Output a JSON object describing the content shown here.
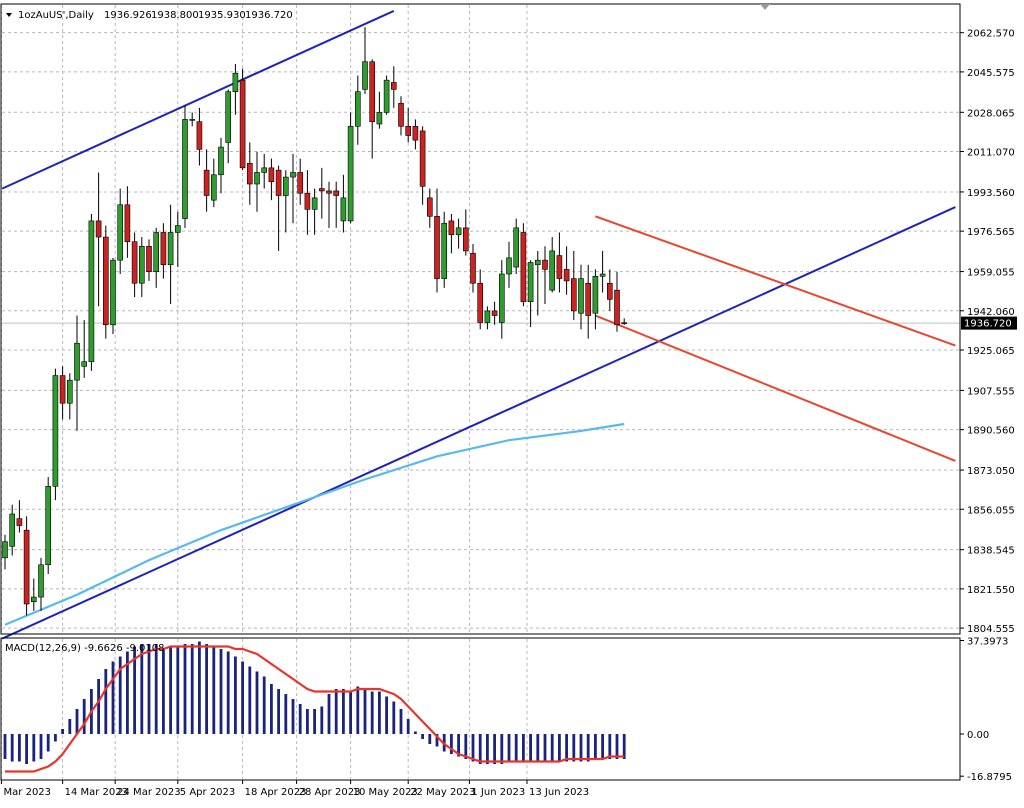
{
  "header": {
    "symbol": "1ozAuUS',Daily",
    "open": "1936.926",
    "high": "1938.800",
    "low": "1935.930",
    "close": "1936.720"
  },
  "price_axis": {
    "ticks": [
      "2062.570",
      "2045.575",
      "2028.065",
      "2011.070",
      "1993.560",
      "1976.565",
      "1959.055",
      "1942.060",
      "1925.065",
      "1907.555",
      "1890.560",
      "1873.050",
      "1856.055",
      "1838.545",
      "1821.550",
      "1804.555"
    ],
    "current_price_label": "1936.720"
  },
  "macd_panel": {
    "label": "MACD(12,26,9) -9.6626 -9.0108",
    "ticks": [
      "37.3973",
      "0.00",
      "-16.8795"
    ]
  },
  "date_axis": {
    "labels": [
      "2 Mar 2023",
      "14 Mar 2023",
      "24 Mar 2023",
      "5 Apr 2023",
      "18 Apr 2023",
      "28 Apr 2023",
      "10 May 2023",
      "22 May 2023",
      "1 Jun 2023",
      "13 Jun 2023"
    ]
  },
  "colors": {
    "bull": "#2e9d2e",
    "bear": "#cc2222",
    "wick": "#000000",
    "channel_blue": "#1f24b8",
    "channel_red": "#e8462d",
    "ma": "#57b9ee",
    "macd_hist": "#1a237e",
    "macd_signal": "#e8352a",
    "grid": "#b8b8b8"
  },
  "chart_data": {
    "type": "candlestick",
    "title": "1ozAuUS',Daily",
    "ylim": [
      1802,
      2075
    ],
    "candles": [
      {
        "o": 1835,
        "h": 1845,
        "l": 1830,
        "c": 1842
      },
      {
        "o": 1840,
        "h": 1858,
        "l": 1836,
        "c": 1854
      },
      {
        "o": 1852,
        "h": 1860,
        "l": 1846,
        "c": 1849
      },
      {
        "o": 1847,
        "h": 1853,
        "l": 1810,
        "c": 1815
      },
      {
        "o": 1816,
        "h": 1826,
        "l": 1812,
        "c": 1818
      },
      {
        "o": 1818,
        "h": 1835,
        "l": 1812,
        "c": 1832
      },
      {
        "o": 1832,
        "h": 1870,
        "l": 1828,
        "c": 1866
      },
      {
        "o": 1866,
        "h": 1917,
        "l": 1860,
        "c": 1914
      },
      {
        "o": 1914,
        "h": 1918,
        "l": 1895,
        "c": 1902
      },
      {
        "o": 1902,
        "h": 1915,
        "l": 1895,
        "c": 1912
      },
      {
        "o": 1912,
        "h": 1940,
        "l": 1890,
        "c": 1928
      },
      {
        "o": 1918,
        "h": 1938,
        "l": 1913,
        "c": 1920
      },
      {
        "o": 1920,
        "h": 1984,
        "l": 1916,
        "c": 1981
      },
      {
        "o": 1981,
        "h": 2002,
        "l": 1944,
        "c": 1974
      },
      {
        "o": 1974,
        "h": 1979,
        "l": 1930,
        "c": 1936
      },
      {
        "o": 1936,
        "h": 1965,
        "l": 1932,
        "c": 1964
      },
      {
        "o": 1964,
        "h": 1995,
        "l": 1958,
        "c": 1988
      },
      {
        "o": 1988,
        "h": 1996,
        "l": 1965,
        "c": 1972
      },
      {
        "o": 1972,
        "h": 1976,
        "l": 1948,
        "c": 1954
      },
      {
        "o": 1954,
        "h": 1974,
        "l": 1948,
        "c": 1970
      },
      {
        "o": 1970,
        "h": 1973,
        "l": 1955,
        "c": 1959
      },
      {
        "o": 1959,
        "h": 1978,
        "l": 1952,
        "c": 1976
      },
      {
        "o": 1976,
        "h": 1980,
        "l": 1956,
        "c": 1962
      },
      {
        "o": 1962,
        "h": 1988,
        "l": 1945,
        "c": 1976
      },
      {
        "o": 1976,
        "h": 1985,
        "l": 1961,
        "c": 1979
      },
      {
        "o": 1982,
        "h": 2031,
        "l": 1978,
        "c": 2025
      },
      {
        "o": 2025,
        "h": 2028,
        "l": 2022,
        "c": 2025
      },
      {
        "o": 2024,
        "h": 2030,
        "l": 2005,
        "c": 2012
      },
      {
        "o": 2003,
        "h": 2012,
        "l": 1985,
        "c": 1992
      },
      {
        "o": 1990,
        "h": 2008,
        "l": 1987,
        "c": 2001
      },
      {
        "o": 2001,
        "h": 2017,
        "l": 1993,
        "c": 2013
      },
      {
        "o": 2015,
        "h": 2038,
        "l": 2006,
        "c": 2037
      },
      {
        "o": 2037,
        "h": 2049,
        "l": 2027,
        "c": 2045
      },
      {
        "o": 2042,
        "h": 2047,
        "l": 2003,
        "c": 2004
      },
      {
        "o": 2006,
        "h": 2015,
        "l": 1988,
        "c": 1997
      },
      {
        "o": 1997,
        "h": 2011,
        "l": 1985,
        "c": 2002
      },
      {
        "o": 2002,
        "h": 2010,
        "l": 1995,
        "c": 2004
      },
      {
        "o": 2004,
        "h": 2008,
        "l": 1990,
        "c": 1998
      },
      {
        "o": 2003,
        "h": 2005,
        "l": 1968,
        "c": 1992
      },
      {
        "o": 1992,
        "h": 2003,
        "l": 1976,
        "c": 2000
      },
      {
        "o": 2000,
        "h": 2010,
        "l": 1980,
        "c": 2002
      },
      {
        "o": 2002,
        "h": 2008,
        "l": 1988,
        "c": 1993
      },
      {
        "o": 1993,
        "h": 2003,
        "l": 1975,
        "c": 1986
      },
      {
        "o": 1986,
        "h": 1995,
        "l": 1975,
        "c": 1991
      },
      {
        "o": 1995,
        "h": 2004,
        "l": 1982,
        "c": 1994
      },
      {
        "o": 1994,
        "h": 1998,
        "l": 1978,
        "c": 1993
      },
      {
        "o": 1994,
        "h": 1998,
        "l": 1978,
        "c": 1992
      },
      {
        "o": 1981,
        "h": 2001,
        "l": 1976,
        "c": 1991
      },
      {
        "o": 1981,
        "h": 2028,
        "l": 1980,
        "c": 2022
      },
      {
        "o": 2022,
        "h": 2044,
        "l": 2014,
        "c": 2037
      },
      {
        "o": 2038,
        "h": 2065,
        "l": 2036,
        "c": 2050
      },
      {
        "o": 2050,
        "h": 2051,
        "l": 2008,
        "c": 2024
      },
      {
        "o": 2023,
        "h": 2037,
        "l": 2021,
        "c": 2028
      },
      {
        "o": 2028,
        "h": 2044,
        "l": 2027,
        "c": 2042
      },
      {
        "o": 2041,
        "h": 2048,
        "l": 2030,
        "c": 2038
      },
      {
        "o": 2032,
        "h": 2035,
        "l": 2018,
        "c": 2022
      },
      {
        "o": 2022,
        "h": 2030,
        "l": 2015,
        "c": 2018
      },
      {
        "o": 2022,
        "h": 2025,
        "l": 2012,
        "c": 2016
      },
      {
        "o": 2020,
        "h": 2022,
        "l": 1988,
        "c": 1996
      },
      {
        "o": 1991,
        "h": 1995,
        "l": 1978,
        "c": 1983
      },
      {
        "o": 1983,
        "h": 1995,
        "l": 1950,
        "c": 1956
      },
      {
        "o": 1956,
        "h": 1985,
        "l": 1952,
        "c": 1980
      },
      {
        "o": 1981,
        "h": 1984,
        "l": 1967,
        "c": 1975
      },
      {
        "o": 1975,
        "h": 1982,
        "l": 1969,
        "c": 1978
      },
      {
        "o": 1978,
        "h": 1986,
        "l": 1966,
        "c": 1968
      },
      {
        "o": 1967,
        "h": 1971,
        "l": 1950,
        "c": 1954
      },
      {
        "o": 1954,
        "h": 1960,
        "l": 1934,
        "c": 1937
      },
      {
        "o": 1937,
        "h": 1944,
        "l": 1934,
        "c": 1942
      },
      {
        "o": 1942,
        "h": 1946,
        "l": 1936,
        "c": 1940
      },
      {
        "o": 1937,
        "h": 1964,
        "l": 1930,
        "c": 1958
      },
      {
        "o": 1958,
        "h": 1972,
        "l": 1952,
        "c": 1965
      },
      {
        "o": 1961,
        "h": 1982,
        "l": 1958,
        "c": 1978
      },
      {
        "o": 1976,
        "h": 1980,
        "l": 1944,
        "c": 1946
      },
      {
        "o": 1946,
        "h": 1964,
        "l": 1935,
        "c": 1963
      },
      {
        "o": 1962,
        "h": 1968,
        "l": 1940,
        "c": 1964
      },
      {
        "o": 1964,
        "h": 1970,
        "l": 1945,
        "c": 1960
      },
      {
        "o": 1951,
        "h": 1974,
        "l": 1950,
        "c": 1968
      },
      {
        "o": 1966,
        "h": 1976,
        "l": 1950,
        "c": 1956
      },
      {
        "o": 1960,
        "h": 1970,
        "l": 1949,
        "c": 1955
      },
      {
        "o": 1956,
        "h": 1968,
        "l": 1938,
        "c": 1942
      },
      {
        "o": 1941,
        "h": 1962,
        "l": 1934,
        "c": 1956
      },
      {
        "o": 1954,
        "h": 1962,
        "l": 1930,
        "c": 1940
      },
      {
        "o": 1941,
        "h": 1960,
        "l": 1934,
        "c": 1957
      },
      {
        "o": 1957,
        "h": 1968,
        "l": 1950,
        "c": 1958
      },
      {
        "o": 1954,
        "h": 1960,
        "l": 1942,
        "c": 1947
      },
      {
        "o": 1951,
        "h": 1959,
        "l": 1933,
        "c": 1936
      },
      {
        "o": 1936.9,
        "h": 1938.8,
        "l": 1935.9,
        "c": 1936.7
      }
    ],
    "trendlines": [
      {
        "name": "blue-upper",
        "color": "blue",
        "x": [
          -0.4,
          54.0
        ],
        "y": [
          1995,
          2072
        ]
      },
      {
        "name": "blue-lower",
        "color": "blue",
        "x": [
          -0.4,
          132.0
        ],
        "y": [
          1800,
          1987
        ]
      },
      {
        "name": "red-upper",
        "color": "red",
        "x": [
          82.0,
          132.0
        ],
        "y": [
          1983,
          1927
        ]
      },
      {
        "name": "red-lower",
        "color": "red",
        "x": [
          82.0,
          132.0
        ],
        "y": [
          1940,
          1877
        ]
      }
    ],
    "moving_average": {
      "x": [
        0,
        10,
        20,
        30,
        40,
        50,
        60,
        70,
        80,
        86
      ],
      "y": [
        1806,
        1819,
        1834,
        1847,
        1858,
        1869,
        1879,
        1886,
        1890,
        1893
      ]
    },
    "macd": {
      "ylim": [
        -18,
        38
      ],
      "histogram": [
        -10,
        -11,
        -11,
        -12,
        -11,
        -10,
        -7,
        -3,
        2,
        6,
        10,
        14,
        18,
        22,
        26,
        29,
        31,
        33,
        35,
        36,
        36,
        36,
        34,
        35,
        35,
        36,
        36,
        37,
        36,
        35,
        34,
        33,
        31,
        29,
        27,
        25,
        23,
        20,
        18,
        16,
        14,
        12,
        10,
        10,
        11,
        16,
        18,
        18,
        17,
        19,
        18,
        17,
        17,
        15,
        13,
        10,
        6,
        1,
        -2,
        -4,
        -5,
        -7,
        -8,
        -9,
        -10,
        -11,
        -12,
        -12,
        -12,
        -12,
        -11,
        -11,
        -11,
        -11,
        -11,
        -11,
        -11,
        -11,
        -11,
        -11,
        -11,
        -11,
        -10,
        -10,
        -10,
        -10,
        -10
      ],
      "signal": [
        -15,
        -15,
        -15,
        -15,
        -15,
        -14,
        -13,
        -11,
        -8,
        -4,
        0,
        4,
        9,
        13,
        18,
        22,
        26,
        28,
        30,
        32,
        33,
        34,
        34,
        35,
        35,
        35,
        35,
        35,
        35,
        35,
        35,
        35,
        34,
        34,
        33,
        32,
        30,
        28,
        26,
        24,
        22,
        20,
        18,
        17,
        17,
        17,
        17,
        17,
        17,
        18,
        18,
        18,
        18,
        17,
        16,
        14,
        11,
        8,
        5,
        2,
        -1,
        -4,
        -6,
        -8,
        -9,
        -10,
        -11,
        -11,
        -11,
        -11,
        -11,
        -11,
        -11,
        -11,
        -11,
        -11,
        -11,
        -11,
        -10,
        -10,
        -10,
        -10,
        -10,
        -10,
        -9,
        -9,
        -9
      ]
    }
  }
}
